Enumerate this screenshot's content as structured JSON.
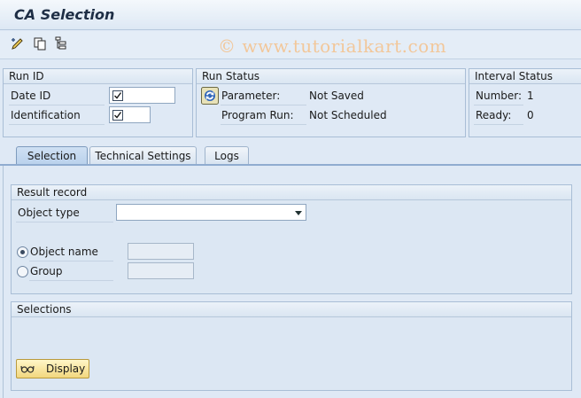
{
  "window": {
    "title": "CA Selection"
  },
  "watermark": "© www.tutorialkart.com",
  "toolbar": {
    "icons": [
      "execute-pencil-icon",
      "copy-icon",
      "tree-structure-icon"
    ]
  },
  "run_id": {
    "header": "Run ID",
    "date_id_label": "Date ID",
    "identification_label": "Identification"
  },
  "run_status": {
    "header": "Run Status",
    "parameter_label": "Parameter:",
    "parameter_value": "Not Saved",
    "program_run_label": "Program Run:",
    "program_run_value": "Not Scheduled"
  },
  "interval_status": {
    "header": "Interval Status",
    "number_label": "Number:",
    "number_value": "1",
    "ready_label": "Ready:",
    "ready_value": "0"
  },
  "tabs": [
    {
      "label": "Selection",
      "active": true
    },
    {
      "label": "Technical Settings",
      "active": false
    },
    {
      "label": "Logs",
      "active": false
    }
  ],
  "result_record": {
    "header": "Result record",
    "object_type_label": "Object type",
    "object_type_value": "",
    "object_name_label": "Object name",
    "group_label": "Group",
    "selected_option": "Object name"
  },
  "selections": {
    "header": "Selections",
    "display_button": "Display"
  },
  "colors": {
    "background": "#dfe9f5",
    "accent": "#90acd0",
    "button": "#f2d77e"
  }
}
